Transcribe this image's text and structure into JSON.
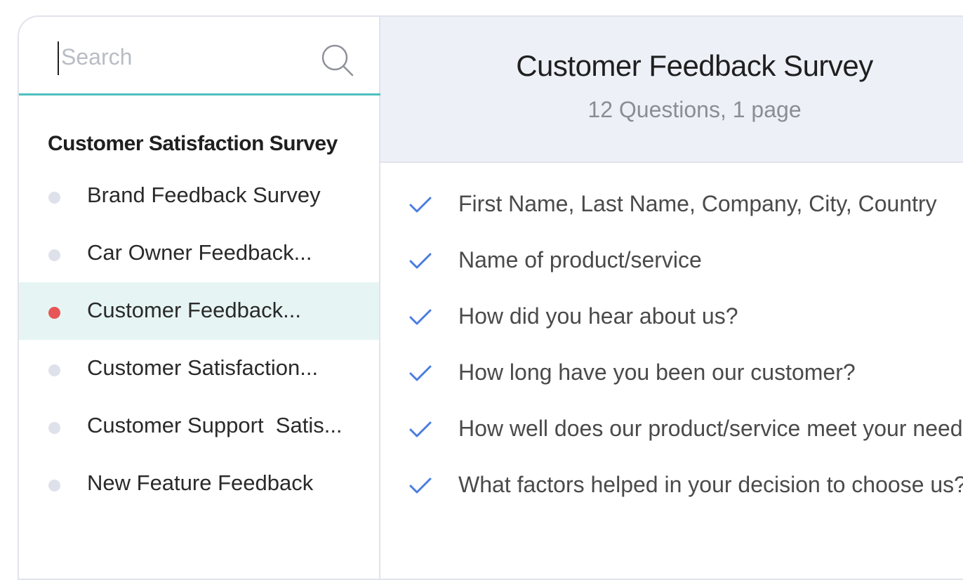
{
  "search": {
    "placeholder": "Search"
  },
  "sidebar": {
    "group_title": "Customer Satisfaction Survey",
    "items": [
      {
        "label": "Brand Feedback Survey",
        "active": false
      },
      {
        "label": "Car Owner Feedback...",
        "active": false
      },
      {
        "label": "Customer Feedback...",
        "active": true
      },
      {
        "label": "Customer Satisfaction...",
        "active": false
      },
      {
        "label": "Customer Support  Satis...",
        "active": false
      },
      {
        "label": "New Feature Feedback",
        "active": false
      }
    ]
  },
  "main": {
    "title": "Customer Feedback Survey",
    "subtitle": "12 Questions, 1 page",
    "questions": [
      "First Name, Last Name, Company, City, Country",
      "Name of product/service",
      "How did you hear about us?",
      "How long have you been our customer?",
      "How well does our product/service meet your needs?",
      "What factors helped in your decision to choose us?"
    ]
  },
  "colors": {
    "accent_teal": "#4fc0bf",
    "active_dot": "#e65656",
    "check_blue": "#4a7de0",
    "header_bg": "#edf0f7",
    "active_bg": "#e6f5f4"
  },
  "icons": {
    "search": "search-icon",
    "check": "check-icon",
    "dot": "bullet-dot"
  }
}
